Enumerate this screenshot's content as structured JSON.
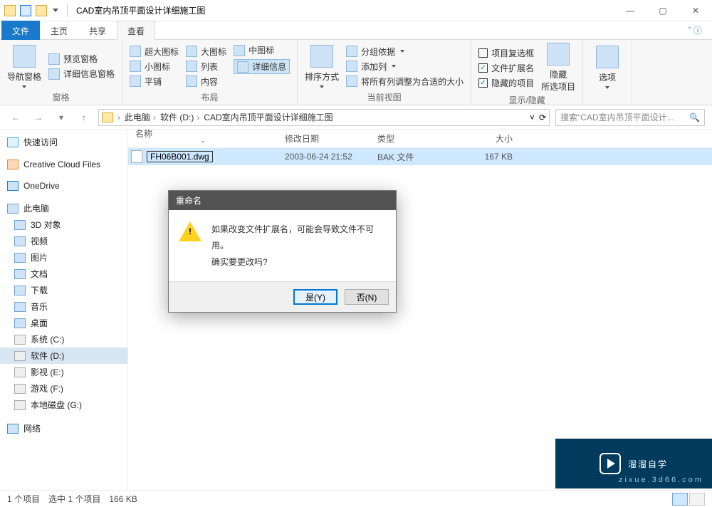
{
  "title": "CAD室内吊顶平面设计详细施工图",
  "tabs": {
    "file": "文件",
    "home": "主页",
    "share": "共享",
    "view": "查看"
  },
  "ribbon": {
    "panes": {
      "nav": "导航窗格",
      "preview": "预览窗格",
      "details": "详细信息窗格",
      "label": "窗格"
    },
    "layout": {
      "xl": "超大图标",
      "l": "大图标",
      "m": "中图标",
      "s": "小图标",
      "list": "列表",
      "det": "详细信息",
      "tile": "平铺",
      "content": "内容",
      "label": "布局"
    },
    "current": {
      "sort": "排序方式",
      "group": "分组依据",
      "addcol": "添加列",
      "fit": "将所有列调整为合适的大小",
      "label": "当前视图"
    },
    "showhide": {
      "chk_item": "项目复选框",
      "chk_ext": "文件扩展名",
      "chk_hidden": "隐藏的项目",
      "hide": "隐藏\n所选项目",
      "label": "显示/隐藏"
    },
    "options": "选项"
  },
  "breadcrumb": [
    "此电脑",
    "软件 (D:)",
    "CAD室内吊顶平面设计详细施工图"
  ],
  "search_placeholder": "搜索\"CAD室内吊顶平面设计...",
  "side": {
    "quick": "快速访问",
    "cc": "Creative Cloud Files",
    "od": "OneDrive",
    "pc": "此电脑",
    "pc_items": [
      "3D 对象",
      "视频",
      "图片",
      "文档",
      "下载",
      "音乐",
      "桌面",
      "系统 (C:)",
      "软件 (D:)",
      "影视 (E:)",
      "游戏 (F:)",
      "本地磁盘 (G:)"
    ],
    "net": "网络"
  },
  "columns": {
    "name": "名称",
    "date": "修改日期",
    "type": "类型",
    "size": "大小"
  },
  "file": {
    "name": "FH06B001.dwg",
    "date": "2003-06-24 21:52",
    "type": "BAK 文件",
    "size": "167 KB"
  },
  "dialog": {
    "title": "重命名",
    "line1": "如果改变文件扩展名，可能会导致文件不可用。",
    "line2": "确实要更改吗?",
    "yes": "是(Y)",
    "no": "否(N)"
  },
  "status": {
    "count": "1 个项目",
    "sel": "选中 1 个项目",
    "size": "166 KB"
  },
  "watermark": {
    "brand": "溜溜自学",
    "sub": "zixue.3d66.com"
  }
}
